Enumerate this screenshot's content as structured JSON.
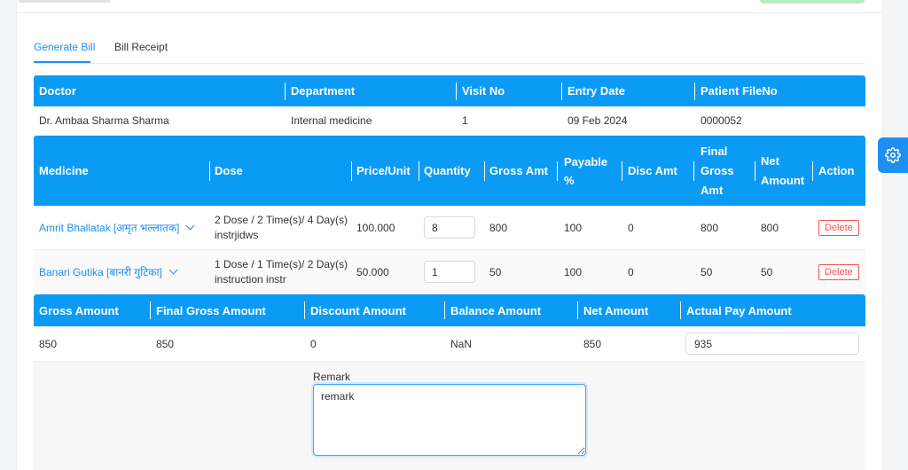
{
  "tabs": [
    {
      "label": "Generate Bill",
      "active": true
    },
    {
      "label": "Bill Receipt",
      "active": false
    }
  ],
  "visit": {
    "headers": [
      "Doctor",
      "Department",
      "Visit No",
      "Entry Date",
      "Patient FileNo"
    ],
    "values": [
      "Dr. Ambaa Sharma Sharma",
      "Internal medicine",
      "1",
      "09 Feb 2024",
      "0000052"
    ]
  },
  "medicine_table": {
    "headers": {
      "medicine": "Medicine",
      "dose": "Dose",
      "price": "Price/Unit",
      "quantity": "Quantity",
      "gross": "Gross Amt",
      "payable": "Payable %",
      "disc": "Disc Amt",
      "final_gross": "Final Gross Amt",
      "net": "Net Amount",
      "action": "Action"
    },
    "rows": [
      {
        "medicine": "Amrit Bhallatak [अमृत भल्लातक]",
        "dose_line1": "2 Dose / 2 Time(s)/ 4 Day(s)",
        "dose_line2": "instrjidws",
        "price": "100.000",
        "quantity": "8",
        "gross": "800",
        "payable": "100",
        "disc": "0",
        "final_gross": "800",
        "net": "800",
        "action": "Delete"
      },
      {
        "medicine": "Banari Gutika [बानरी गुटिका]",
        "dose_line1": "1 Dose / 1 Time(s)/ 2 Day(s)",
        "dose_line2": "instruction instr",
        "price": "50.000",
        "quantity": "1",
        "gross": "50",
        "payable": "100",
        "disc": "0",
        "final_gross": "50",
        "net": "50",
        "action": "Delete"
      }
    ]
  },
  "summary": {
    "headers": [
      "Gross Amount",
      "Final Gross Amount",
      "Discount Amount",
      "Balance Amount",
      "Net Amount",
      "Actual Pay Amount"
    ],
    "gross": "850",
    "final_gross": "850",
    "discount": "0",
    "balance": "NaN",
    "net": "850",
    "actual_pay": "935"
  },
  "remark": {
    "label": "Remark",
    "value": "remark"
  },
  "icons": {
    "settings": "gear-icon"
  },
  "colors": {
    "header_blue": "#0c9bf4",
    "link_blue": "#1f8ef1",
    "delete_red": "#ff4d4f"
  }
}
